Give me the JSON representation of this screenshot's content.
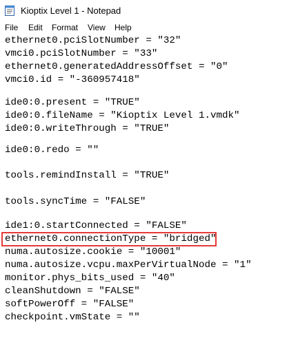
{
  "window": {
    "title": "Kioptix Level 1 - Notepad",
    "icon": "notepad-icon"
  },
  "menu": {
    "items": [
      {
        "label": "File"
      },
      {
        "label": "Edit"
      },
      {
        "label": "Format"
      },
      {
        "label": "View"
      },
      {
        "label": "Help"
      }
    ]
  },
  "editor": {
    "lines": [
      "ethernet0.pciSlotNumber = \"32\"",
      "vmci0.pciSlotNumber = \"33\"",
      "ethernet0.generatedAddressOffset = \"0\"",
      "vmci0.id = \"-360957418\"",
      "",
      "ide0:0.present = \"TRUE\"",
      "ide0:0.fileName = \"Kioptix Level 1.vmdk\"",
      "ide0:0.writeThrough = \"TRUE\"",
      "",
      "ide0:0.redo = \"\"",
      "",
      "tools.remindInstall = \"TRUE\"",
      "",
      "tools.syncTime = \"FALSE\"",
      "",
      "ide1:0.startConnected = \"FALSE\"",
      "ethernet0.connectionType = \"bridged\"",
      "numa.autosize.cookie = \"10001\"",
      "numa.autosize.vcpu.maxPerVirtualNode = \"1\"",
      "monitor.phys_bits_used = \"40\"",
      "cleanShutdown = \"FALSE\"",
      "softPowerOff = \"FALSE\"",
      "checkpoint.vmState = \"\""
    ],
    "highlight_color": "#e53935"
  }
}
